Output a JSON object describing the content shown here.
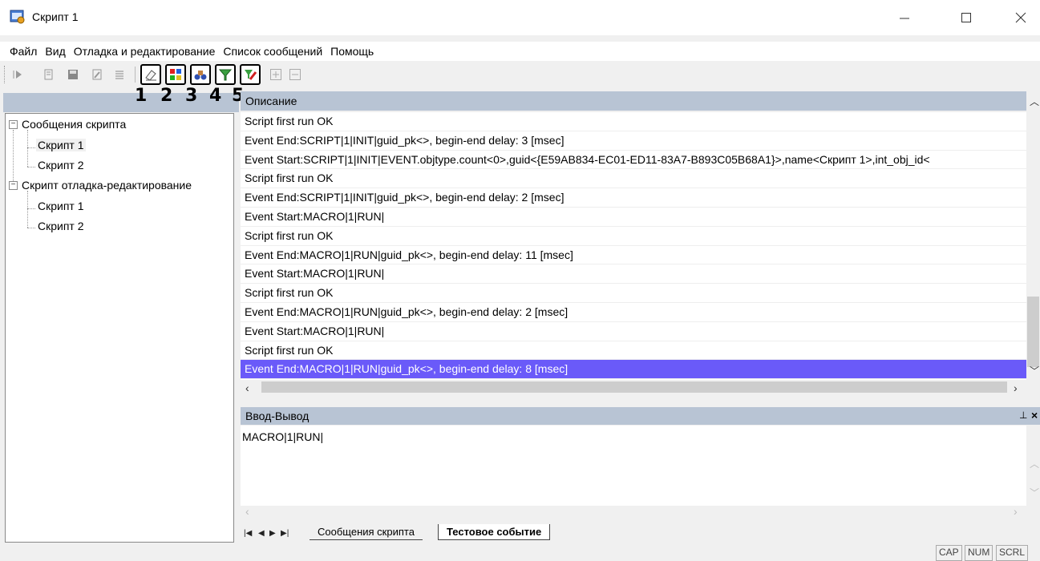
{
  "window": {
    "title": "Скрипт 1"
  },
  "menu": [
    "Файл",
    "Вид",
    "Отладка и редактирование",
    "Список сообщений",
    "Помощь"
  ],
  "toolbar": {
    "markers": [
      "1",
      "2",
      "3",
      "4",
      "5"
    ]
  },
  "tree": {
    "groups": [
      {
        "label": "Сообщения скрипта",
        "children": [
          "Скрипт 1",
          "Скрипт 2"
        ]
      },
      {
        "label": "Скрипт отладка-редактирование",
        "children": [
          "Скрипт 1",
          "Скрипт 2"
        ]
      }
    ]
  },
  "list": {
    "header": "Описание",
    "rows": [
      "Script first run OK",
      "Event End:SCRIPT|1|INIT|guid_pk<>, begin-end delay: 3 [msec]",
      "Event Start:SCRIPT|1|INIT|EVENT.objtype.count<0>,guid<{E59AB834-EC01-ED11-83A7-B893C05B68A1}>,name<Скрипт 1>,int_obj_id<",
      "Script first run OK",
      "Event End:SCRIPT|1|INIT|guid_pk<>, begin-end delay: 2 [msec]",
      "Event Start:MACRO|1|RUN|",
      "Script first run OK",
      "Event End:MACRO|1|RUN|guid_pk<>, begin-end delay: 11 [msec]",
      "Event Start:MACRO|1|RUN|",
      "Script first run OK",
      "Event End:MACRO|1|RUN|guid_pk<>, begin-end delay: 2 [msec]",
      "Event Start:MACRO|1|RUN|",
      "Script first run OK",
      "Event End:MACRO|1|RUN|guid_pk<>, begin-end delay: 8 [msec]"
    ],
    "selected_index": 13
  },
  "io": {
    "title": "Ввод-Вывод",
    "value": "MACRO|1|RUN|"
  },
  "tabs": [
    "Сообщения скрипта",
    "Тестовое событие"
  ],
  "status": [
    "CAP",
    "NUM",
    "SCRL"
  ]
}
